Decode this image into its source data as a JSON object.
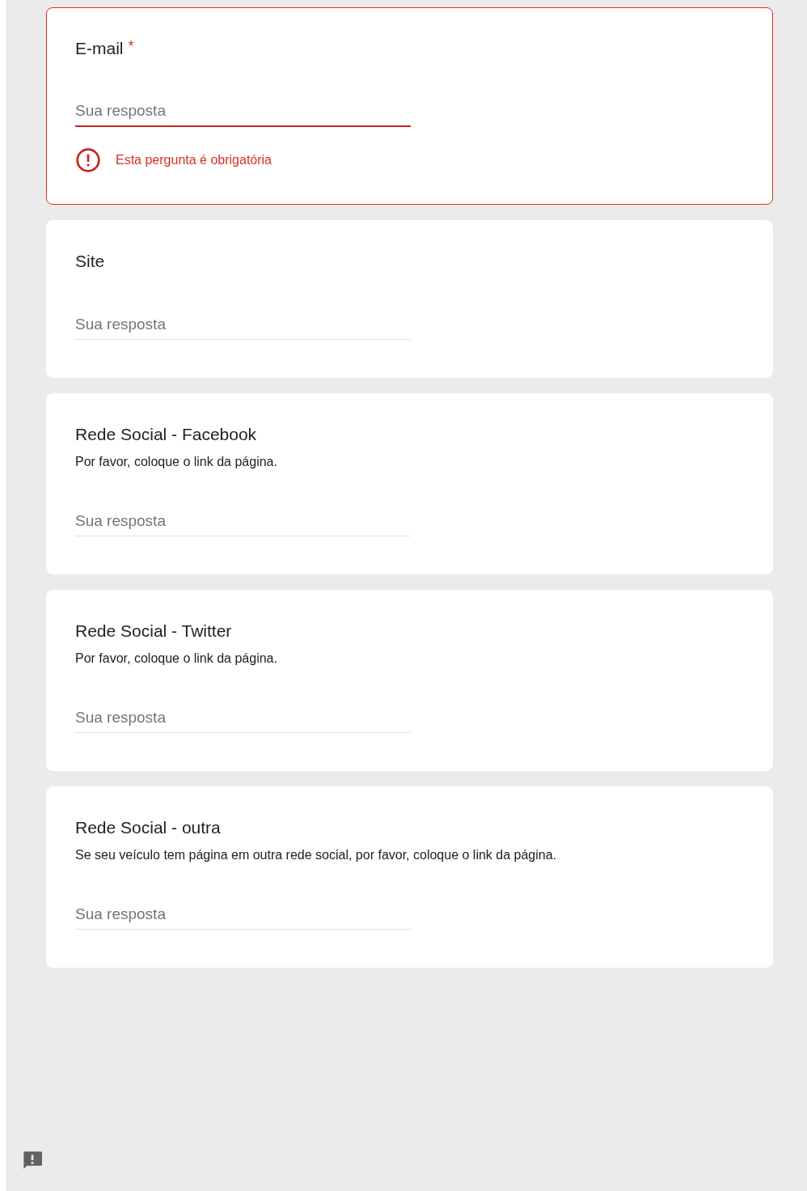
{
  "questions": [
    {
      "title": "E-mail",
      "required_mark": "*",
      "placeholder": "Sua resposta",
      "error": "Esta pergunta é obrigatória"
    },
    {
      "title": "Site",
      "placeholder": "Sua resposta"
    },
    {
      "title": "Rede Social - Facebook",
      "description": "Por favor, coloque o link da página.",
      "placeholder": "Sua resposta"
    },
    {
      "title": "Rede Social - Twitter",
      "description": "Por favor, coloque o link da página.",
      "placeholder": "Sua resposta"
    },
    {
      "title": "Rede Social - outra",
      "description": "Se seu veículo tem página em outra rede social, por favor, coloque o link da página.",
      "placeholder": "Sua resposta"
    }
  ]
}
